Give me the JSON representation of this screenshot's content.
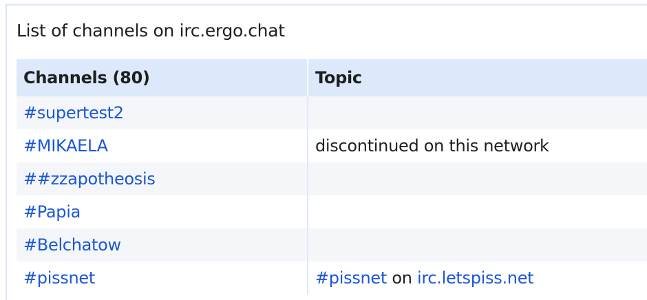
{
  "heading": "List of channels on irc.ergo.chat",
  "table": {
    "headers": {
      "channels": "Channels (80)",
      "topic": "Topic"
    },
    "rows": [
      {
        "channel": "#supertest2",
        "topic": []
      },
      {
        "channel": "#MIKAELA",
        "topic": [
          {
            "text": "discontinued on this network",
            "link": false
          }
        ]
      },
      {
        "channel": "##zzapotheosis",
        "topic": []
      },
      {
        "channel": "#Papia",
        "topic": []
      },
      {
        "channel": "#Belchatow",
        "topic": []
      },
      {
        "channel": "#pissnet",
        "topic": [
          {
            "text": "#pissnet",
            "link": true
          },
          {
            "text": " on ",
            "link": false
          },
          {
            "text": "irc.letspiss.net",
            "link": true
          }
        ]
      }
    ]
  },
  "colors": {
    "link": "#1a57d6",
    "header_bg": "#dde9fb",
    "stripe_bg": "#f4f6f9",
    "text": "#1f1f1f"
  }
}
